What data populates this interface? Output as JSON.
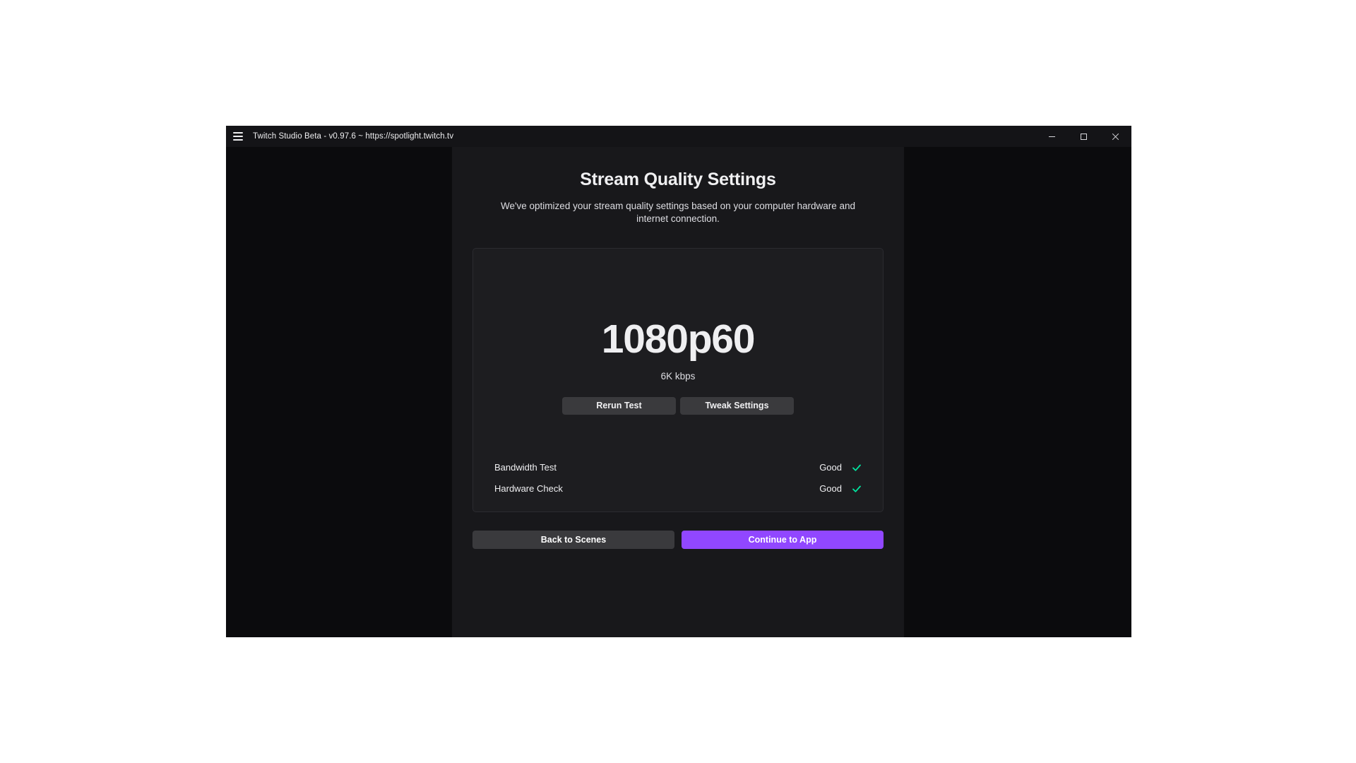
{
  "window": {
    "title": "Twitch Studio Beta - v0.97.6 ~ https://spotlight.twitch.tv",
    "menu_icon": "hamburger-menu-icon",
    "controls": {
      "minimize": "minimize-icon",
      "maximize": "maximize-icon",
      "close": "close-icon"
    }
  },
  "page": {
    "title": "Stream Quality Settings",
    "subtitle": "We've optimized your stream quality settings based on your computer hardware and internet connection."
  },
  "result_card": {
    "quality": "1080p60",
    "bitrate": "6K kbps",
    "actions": {
      "rerun": "Rerun Test",
      "tweak": "Tweak Settings"
    },
    "checks": [
      {
        "label": "Bandwidth Test",
        "status": "Good",
        "icon": "checkmark-icon"
      },
      {
        "label": "Hardware Check",
        "status": "Good",
        "icon": "checkmark-icon"
      }
    ]
  },
  "footer": {
    "back_label": "Back to Scenes",
    "continue_label": "Continue to App"
  },
  "colors": {
    "brand_purple": "#9147ff",
    "success_green": "#00e6a0",
    "window_bg": "#0e0e10",
    "panel_bg": "#18181b",
    "card_bg": "#1d1d20",
    "button_gray": "#3a3a3d",
    "text_primary": "#efeff1"
  }
}
